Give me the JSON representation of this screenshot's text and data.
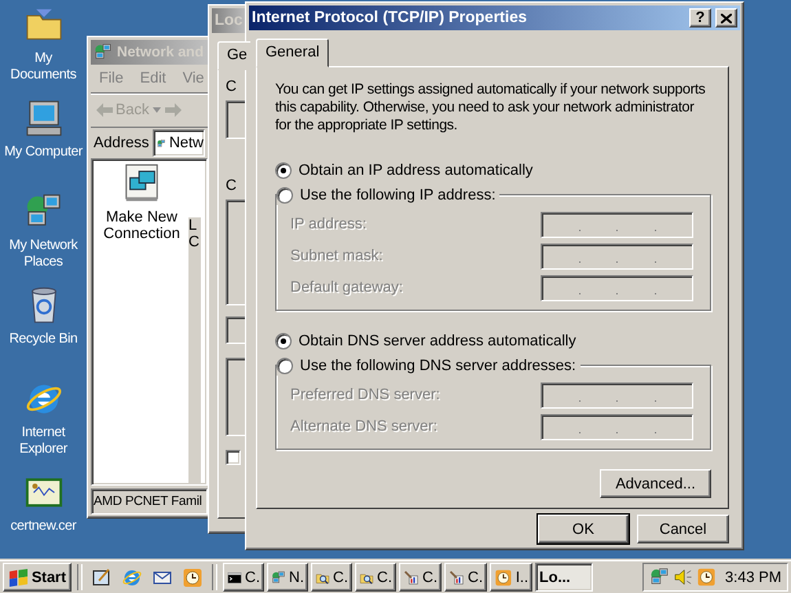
{
  "desktop_icons": [
    {
      "label": "My Documents",
      "kind": "folder"
    },
    {
      "label": "My Computer",
      "kind": "computer"
    },
    {
      "label": "My Network Places",
      "kind": "network"
    },
    {
      "label": "Recycle Bin",
      "kind": "recycle"
    },
    {
      "label": "Internet Explorer",
      "kind": "browser"
    },
    {
      "label": "certnew.cer",
      "kind": "certificate"
    }
  ],
  "network_window": {
    "title": "Network and",
    "active": false,
    "menu": [
      "File",
      "Edit",
      "Vie"
    ],
    "back_label": "Back",
    "address": {
      "label": "Address",
      "value": "Netw"
    },
    "items": [
      {
        "label": "Make New Connection",
        "selected": false
      },
      {
        "label": "L C",
        "selected": true
      }
    ],
    "status_bar": "AMD PCNET Famil"
  },
  "local_window": {
    "title": "Loc",
    "active": false,
    "tab": "Ge",
    "labels": [
      "C",
      "C"
    ],
    "checkbox": {
      "checked": false
    }
  },
  "dialog": {
    "title": "Internet Protocol (TCP/IP) Properties",
    "active": true,
    "tabs": [
      {
        "label": "General",
        "selected": true
      }
    ],
    "description": "You can get IP settings assigned automatically if your network supports this capability. Otherwise, you need to ask your network administrator for the appropriate IP settings.",
    "ip_auto": {
      "label": "Obtain an IP address automatically",
      "selected": true
    },
    "ip_manual": {
      "label": "Use the following IP address:",
      "selected": false,
      "fields": [
        {
          "label": "IP address:",
          "disabled": true
        },
        {
          "label": "Subnet mask:",
          "disabled": true
        },
        {
          "label": "Default gateway:",
          "disabled": true
        }
      ]
    },
    "dns_auto": {
      "label": "Obtain DNS server address automatically",
      "selected": true
    },
    "dns_manual": {
      "label": "Use the following DNS server addresses:",
      "selected": false,
      "fields": [
        {
          "label": "Preferred DNS server:",
          "disabled": true
        },
        {
          "label": "Alternate DNS server:",
          "disabled": true
        }
      ]
    },
    "advanced_button": "Advanced...",
    "buttons": [
      "OK",
      "Cancel"
    ],
    "help_button": "?"
  },
  "taskbar": {
    "start": "Start",
    "quick_launch": [
      {
        "kind": "desktop"
      },
      {
        "kind": "browser"
      },
      {
        "kind": "mail"
      },
      {
        "kind": "clock"
      }
    ],
    "tasks": [
      {
        "label": "C.",
        "kind": "console",
        "selected": false
      },
      {
        "label": "N.",
        "kind": "network",
        "selected": false
      },
      {
        "label": "C.",
        "kind": "search",
        "selected": false
      },
      {
        "label": "C.",
        "kind": "search",
        "selected": false
      },
      {
        "label": "C.",
        "kind": "tools",
        "selected": false
      },
      {
        "label": "C.",
        "kind": "tools",
        "selected": false
      },
      {
        "label": "I..",
        "kind": "clock",
        "selected": false
      },
      {
        "label": "Lo...",
        "kind": "none",
        "selected": true
      }
    ],
    "tray": [
      {
        "kind": "network"
      },
      {
        "kind": "speaker"
      },
      {
        "kind": "clock"
      }
    ],
    "clock": "3:43 PM"
  }
}
